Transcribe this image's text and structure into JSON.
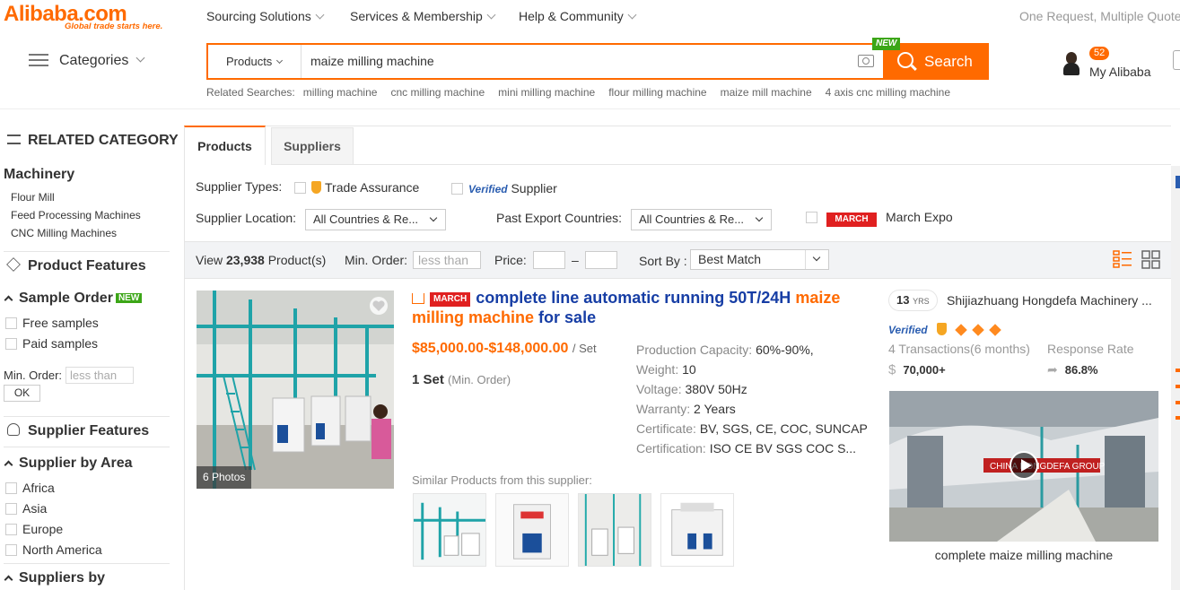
{
  "header": {
    "logo_text": "Alibaba.com",
    "logo_tagline": "Global trade starts here.",
    "nav": [
      "Sourcing Solutions",
      "Services & Membership",
      "Help & Community"
    ],
    "promo": "One Request, Multiple Quotes",
    "categories_label": "Categories",
    "search": {
      "type_label": "Products",
      "query": "maize milling machine",
      "new_badge": "NEW",
      "button_label": "Search"
    },
    "related_label": "Related Searches:",
    "related": [
      "milling machine",
      "cnc milling machine",
      "mini milling machine",
      "flour milling machine",
      "maize mill machine",
      "4 axis cnc milling machine"
    ],
    "notif_count": "52",
    "my_alibaba": "My Alibaba"
  },
  "sidebar": {
    "related_category_title": "RELATED CATEGORY",
    "category": "Machinery",
    "subcategories": [
      "Flour Mill",
      "Feed Processing Machines",
      "CNC Milling Machines"
    ],
    "product_features_title": "Product Features",
    "sample_order_title": "Sample Order",
    "sample_new": "NEW",
    "sample_options": [
      "Free samples",
      "Paid samples"
    ],
    "min_order_label": "Min. Order:",
    "min_order_placeholder": "less than",
    "ok_label": "OK",
    "supplier_features_title": "Supplier Features",
    "supplier_area_title": "Supplier by Area",
    "areas": [
      "Africa",
      "Asia",
      "Europe",
      "North America"
    ],
    "suppliers_by_title": "Suppliers by"
  },
  "main": {
    "tabs": [
      "Products",
      "Suppliers"
    ],
    "filters": {
      "supplier_types_label": "Supplier Types:",
      "trade_assurance": "Trade Assurance",
      "verified_logo": "Verified",
      "supplier_label": "Supplier",
      "location_label": "Supplier Location:",
      "location_value": "All Countries & Re...",
      "past_export_label": "Past Export Countries:",
      "past_export_value": "All Countries & Re...",
      "march_logo": "MARCH",
      "march_expo": "March Expo"
    },
    "viewbar": {
      "view_prefix": "View",
      "count": "23,938",
      "view_suffix": "Product(s)",
      "min_order_label": "Min. Order:",
      "min_order_placeholder": "less than",
      "price_label": "Price:",
      "price_dash": "–",
      "sort_label": "Sort By :",
      "sort_value": "Best Match"
    },
    "product": {
      "photos": "6 Photos",
      "march_logo": "MARCH",
      "title_part1": "complete line automatic running 50T/24H",
      "title_highlight": "maize milling machine",
      "title_part2": "for sale",
      "price": "$85,000.00-$148,000.00",
      "price_unit": "/ Set",
      "moq": "1 Set",
      "moq_suffix": "(Min. Order)",
      "attributes": [
        {
          "k": "Production Capacity:",
          "v": "60%-90%,"
        },
        {
          "k": "Weight:",
          "v": "10"
        },
        {
          "k": "Voltage:",
          "v": "380V 50Hz"
        },
        {
          "k": "Warranty:",
          "v": "2 Years"
        },
        {
          "k": "Certificate:",
          "v": "BV, SGS, CE, COC, SUNCAP"
        },
        {
          "k": "Certification:",
          "v": "ISO CE BV SGS COC S..."
        }
      ],
      "similar_label": "Similar Products from this supplier:"
    },
    "supplier": {
      "years": "13",
      "years_unit": "YRS",
      "name": "Shijiazhuang Hongdefa Machinery ...",
      "verified": "Verified",
      "transactions": "4 Transactions(6 months)",
      "transaction_value": "70,000+",
      "response_label": "Response Rate",
      "response_value": "86.8%",
      "video_caption": "complete maize milling machine",
      "video_overlay": "CHINA HONGDEFA GROUP"
    }
  },
  "colors": {
    "accent": "#ff6a00",
    "title_blue": "#173ea5",
    "new_green": "#3ca617"
  }
}
